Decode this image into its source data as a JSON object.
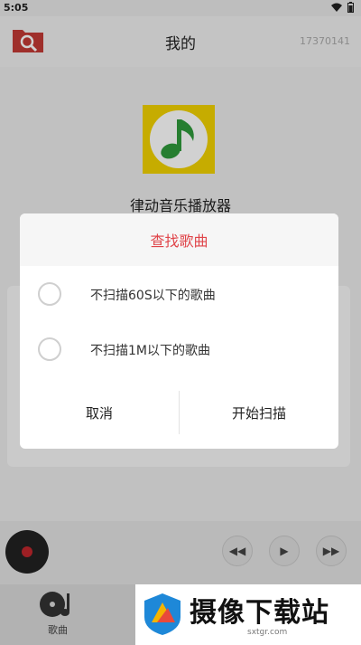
{
  "status": {
    "time": "5:05"
  },
  "appbar": {
    "title": "我的",
    "right_text": "17370141"
  },
  "app": {
    "name": "律动音乐播放器"
  },
  "dialog": {
    "title": "查找歌曲",
    "options": [
      {
        "label": "不扫描60S以下的歌曲"
      },
      {
        "label": "不扫描1M以下的歌曲"
      }
    ],
    "cancel": "取消",
    "confirm": "开始扫描"
  },
  "tabbar": {
    "songs_label": "歌曲"
  },
  "watermark": {
    "title": "摄像下载站",
    "subtitle": "sxtgr.com"
  },
  "colors": {
    "accent": "#e0454a",
    "logo_bg": "#f2d200",
    "note_green": "#2f9a3b"
  }
}
